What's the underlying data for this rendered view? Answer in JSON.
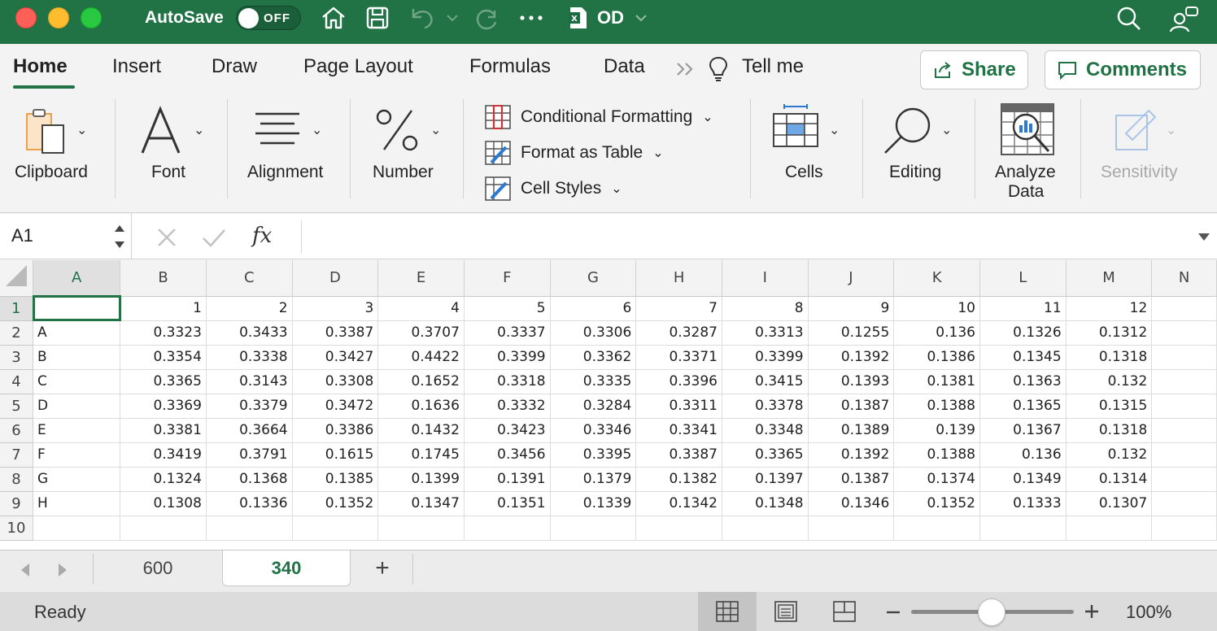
{
  "titlebar": {
    "autosave_label": "AutoSave",
    "autosave_state": "OFF",
    "doc_title": "OD"
  },
  "tabs": {
    "items": [
      "Home",
      "Insert",
      "Draw",
      "Page Layout",
      "Formulas",
      "Data"
    ],
    "tell_me": "Tell me",
    "share": "Share",
    "comments": "Comments"
  },
  "ribbon": {
    "clipboard": "Clipboard",
    "font": "Font",
    "alignment": "Alignment",
    "number": "Number",
    "conditional_formatting": "Conditional Formatting",
    "format_as_table": "Format as Table",
    "cell_styles": "Cell Styles",
    "cells": "Cells",
    "editing": "Editing",
    "analyze_data_line1": "Analyze",
    "analyze_data_line2": "Data",
    "sensitivity": "Sensitivity"
  },
  "formula_bar": {
    "name_box": "A1",
    "fx": "fx",
    "value": ""
  },
  "grid": {
    "columns": [
      "A",
      "B",
      "C",
      "D",
      "E",
      "F",
      "G",
      "H",
      "I",
      "J",
      "K",
      "L",
      "M",
      "N"
    ],
    "rows": [
      [
        "",
        "1",
        "2",
        "3",
        "4",
        "5",
        "6",
        "7",
        "8",
        "9",
        "10",
        "11",
        "12"
      ],
      [
        "A",
        "0.3323",
        "0.3433",
        "0.3387",
        "0.3707",
        "0.3337",
        "0.3306",
        "0.3287",
        "0.3313",
        "0.1255",
        "0.136",
        "0.1326",
        "0.1312"
      ],
      [
        "B",
        "0.3354",
        "0.3338",
        "0.3427",
        "0.4422",
        "0.3399",
        "0.3362",
        "0.3371",
        "0.3399",
        "0.1392",
        "0.1386",
        "0.1345",
        "0.1318"
      ],
      [
        "C",
        "0.3365",
        "0.3143",
        "0.3308",
        "0.1652",
        "0.3318",
        "0.3335",
        "0.3396",
        "0.3415",
        "0.1393",
        "0.1381",
        "0.1363",
        "0.132"
      ],
      [
        "D",
        "0.3369",
        "0.3379",
        "0.3472",
        "0.1636",
        "0.3332",
        "0.3284",
        "0.3311",
        "0.3378",
        "0.1387",
        "0.1388",
        "0.1365",
        "0.1315"
      ],
      [
        "E",
        "0.3381",
        "0.3664",
        "0.3386",
        "0.1432",
        "0.3423",
        "0.3346",
        "0.3341",
        "0.3348",
        "0.1389",
        "0.139",
        "0.1367",
        "0.1318"
      ],
      [
        "F",
        "0.3419",
        "0.3791",
        "0.1615",
        "0.1745",
        "0.3456",
        "0.3395",
        "0.3387",
        "0.3365",
        "0.1392",
        "0.1388",
        "0.136",
        "0.132"
      ],
      [
        "G",
        "0.1324",
        "0.1368",
        "0.1385",
        "0.1399",
        "0.1391",
        "0.1379",
        "0.1382",
        "0.1397",
        "0.1387",
        "0.1374",
        "0.1349",
        "0.1314"
      ],
      [
        "H",
        "0.1308",
        "0.1336",
        "0.1352",
        "0.1347",
        "0.1351",
        "0.1339",
        "0.1342",
        "0.1348",
        "0.1346",
        "0.1352",
        "0.1333",
        "0.1307"
      ],
      [
        "",
        "",
        "",
        "",
        "",
        "",
        "",
        "",
        "",
        "",
        "",
        "",
        ""
      ]
    ],
    "row_numbers": [
      "1",
      "2",
      "3",
      "4",
      "5",
      "6",
      "7",
      "8",
      "9",
      "10"
    ]
  },
  "sheets": {
    "items": [
      "600",
      "340"
    ],
    "active": "340",
    "add": "+"
  },
  "status": {
    "text": "Ready",
    "zoom": "100%"
  }
}
